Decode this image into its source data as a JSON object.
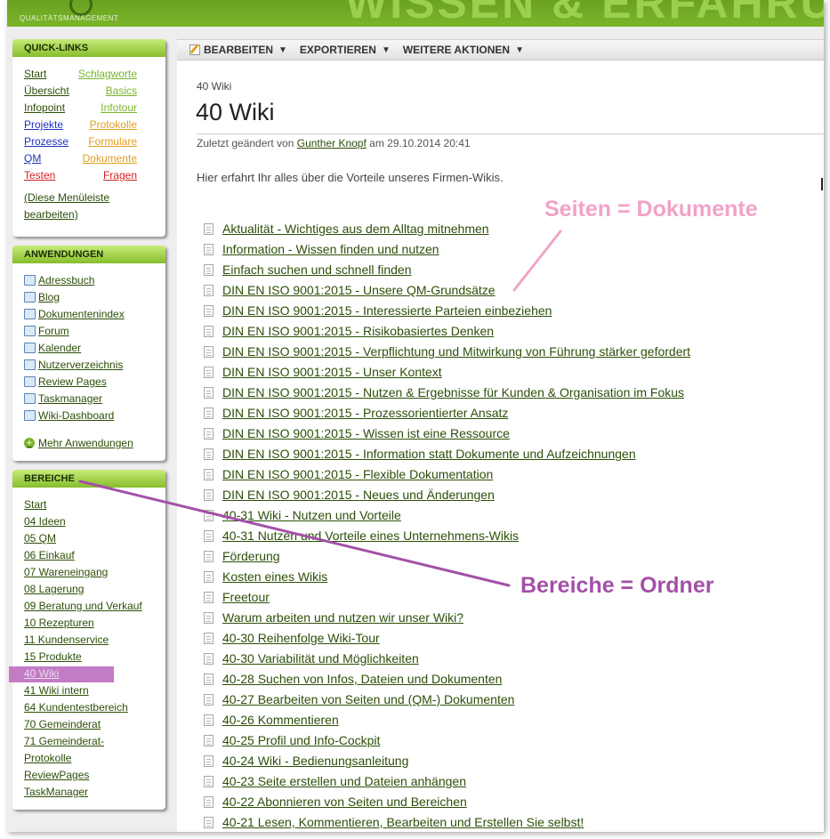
{
  "header": {
    "logo_subtitle": "QUALITÄTSMANAGEMENT",
    "slogan": "WISSEN & ERFAHRUNG"
  },
  "quicklinks": {
    "title": "QUICK-LINKS",
    "items": [
      {
        "label": "Start",
        "color": "#2d4f08"
      },
      {
        "label": "Schlagworte",
        "color": "#7ab52a"
      },
      {
        "label": "Übersicht",
        "color": "#2d4f08"
      },
      {
        "label": "Basics",
        "color": "#7ab52a"
      },
      {
        "label": "Infopoint",
        "color": "#2d4f08"
      },
      {
        "label": "Infotour",
        "color": "#7ab52a"
      },
      {
        "label": "Projekte",
        "color": "#2233bb"
      },
      {
        "label": "Protokolle",
        "color": "#e0a020"
      },
      {
        "label": "Prozesse",
        "color": "#2233bb"
      },
      {
        "label": "Formulare",
        "color": "#e0a020"
      },
      {
        "label": "QM",
        "color": "#2233bb"
      },
      {
        "label": "Dokumente",
        "color": "#e0a020"
      },
      {
        "label": "Testen",
        "color": "#d42020"
      },
      {
        "label": "Fragen",
        "color": "#d42020"
      }
    ],
    "edit_line1": "(Diese Menüleiste",
    "edit_line2": "bearbeiten)"
  },
  "anwendungen": {
    "title": "ANWENDUNGEN",
    "items": [
      {
        "label": "Adressbuch",
        "icon": "address-book-icon"
      },
      {
        "label": "Blog",
        "icon": "blog-icon"
      },
      {
        "label": "Dokumentenindex",
        "icon": "document-index-icon"
      },
      {
        "label": "Forum",
        "icon": "forum-icon"
      },
      {
        "label": "Kalender",
        "icon": "calendar-icon"
      },
      {
        "label": "Nutzerverzeichnis",
        "icon": "users-icon"
      },
      {
        "label": "Review Pages",
        "icon": "review-icon"
      },
      {
        "label": "Taskmanager",
        "icon": "task-icon"
      },
      {
        "label": "Wiki-Dashboard",
        "icon": "dashboard-icon"
      }
    ],
    "more": "Mehr Anwendungen"
  },
  "bereiche": {
    "title": "BEREICHE",
    "active_index": 10,
    "items": [
      "Start",
      "04 Ideen",
      "05 QM",
      "06 Einkauf",
      "07 Wareneingang",
      "08 Lagerung",
      "09 Beratung und Verkauf",
      "10 Rezepturen",
      "11 Kundenservice",
      "15 Produkte",
      "40 Wiki",
      "41 Wiki intern",
      "64 Kundentestbereich",
      "70 Gemeinderat",
      "71 Gemeinderat-",
      "Protokolle",
      "ReviewPages",
      "TaskManager"
    ]
  },
  "toolbar": {
    "edit": "BEARBEITEN",
    "export": "EXPORTIEREN",
    "more": "WEITERE AKTIONEN"
  },
  "page": {
    "breadcrumb": "40 Wiki",
    "title": "40 Wiki",
    "meta_prefix": "Zuletzt geändert von",
    "meta_author": "Gunther Knopf",
    "meta_suffix": "am 29.10.2014 20:41",
    "intro": "Hier erfahrt Ihr alles über die Vorteile unseres Firmen-Wikis."
  },
  "pages": [
    "Aktualität - Wichtiges aus dem Alltag mitnehmen",
    "Information - Wissen finden und nutzen",
    "Einfach suchen und schnell finden",
    "DIN EN ISO 9001:2015 - Unsere QM-Grundsätze",
    "DIN EN ISO 9001:2015 - Interessierte Parteien einbeziehen",
    "DIN EN ISO 9001:2015 - Risikobasiertes Denken",
    "DIN EN ISO 9001:2015 - Verpflichtung und Mitwirkung von Führung stärker gefordert",
    "DIN EN ISO 9001:2015 - Unser Kontext",
    "DIN EN ISO 9001:2015 - Nutzen & Ergebnisse für Kunden & Organisation im Fokus",
    "DIN EN ISO 9001:2015 - Prozessorientierter Ansatz",
    "DIN EN ISO 9001:2015 - Wissen ist eine Ressource",
    "DIN EN ISO 9001:2015 - Information statt Dokumente und Aufzeichnungen",
    "DIN EN ISO 9001:2015 - Flexible Dokumentation",
    "DIN EN ISO 9001:2015 - Neues und Änderungen",
    "40-31 Wiki - Nutzen und Vorteile",
    "40-31 Nutzen und Vorteile eines Unternehmens-Wikis",
    "Förderung",
    "Kosten eines Wikis",
    "Freetour",
    "Warum arbeiten und nutzen wir unser Wiki?",
    "40-30 Reihenfolge Wiki-Tour",
    "40-30 Variabilität und Möglichkeiten",
    "40-28 Suchen von Infos, Dateien und Dokumenten",
    "40-27 Bearbeiten von Seiten und (QM-) Dokumenten",
    "40-26 Kommentieren",
    "40-25 Profil und Info-Cockpit",
    "40-24 Wiki - Bedienungsanleitung",
    "40-23 Seite erstellen und Dateien anhängen",
    "40-22 Abonnieren von Seiten und Bereichen",
    "40-21 Lesen, Kommentieren, Bearbeiten und Erstellen Sie selbst!"
  ],
  "annotations": {
    "pages_label": "Seiten = Dokumente",
    "pages_color": "#f2a2c8",
    "areas_label": "Bereiche = Ordner",
    "areas_color": "#a350a8"
  }
}
